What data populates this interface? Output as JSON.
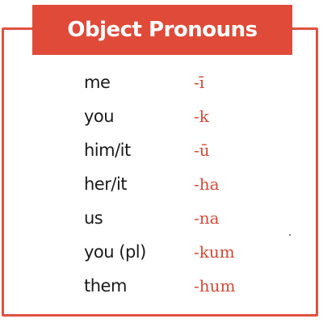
{
  "title": "Object Pronouns",
  "colors": {
    "accent": "#e04a38",
    "suffix_text": "#d64a35",
    "body_text": "#1a1a1a"
  },
  "rows": [
    {
      "english": "me",
      "suffix": "-ī"
    },
    {
      "english": "you",
      "suffix": "-k"
    },
    {
      "english": "him/it",
      "suffix": "-ū"
    },
    {
      "english": "her/it",
      "suffix": "-ha"
    },
    {
      "english": "us",
      "suffix": "-na"
    },
    {
      "english": "you (pl)",
      "suffix": "-kum"
    },
    {
      "english": "them",
      "suffix": "-hum"
    }
  ]
}
